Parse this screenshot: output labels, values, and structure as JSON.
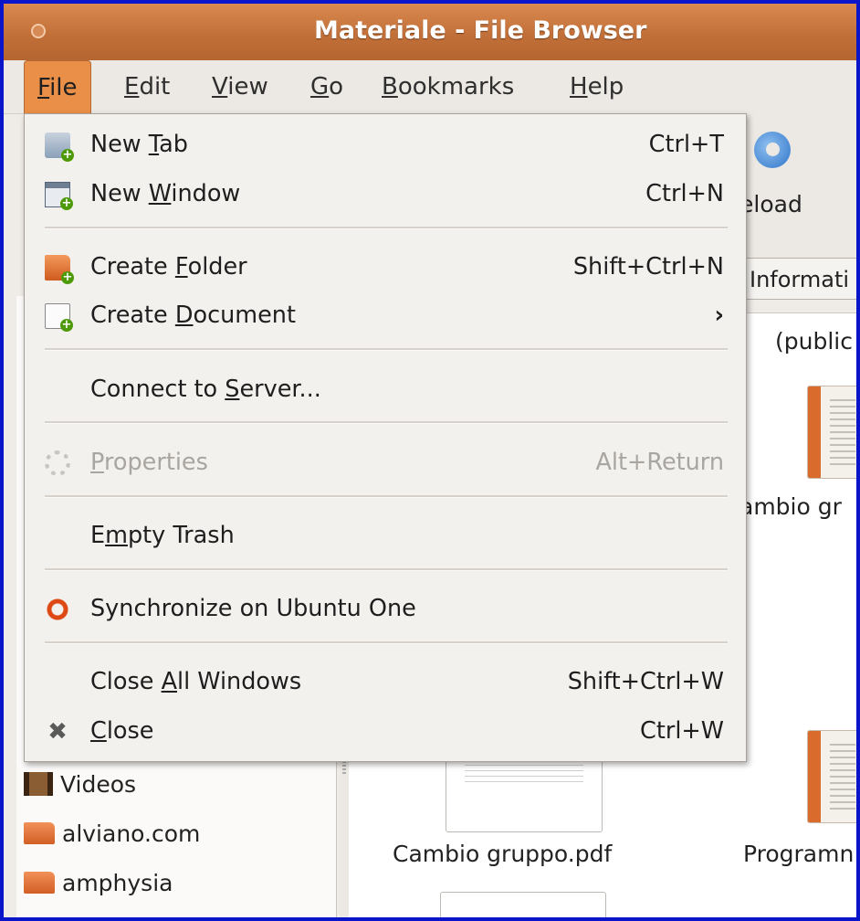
{
  "window": {
    "title": "Materiale - File Browser"
  },
  "menubar": [
    {
      "label": "File",
      "mnemonic": "F",
      "rest": "ile",
      "active": true
    },
    {
      "label": "Edit",
      "mnemonic": "E",
      "rest": "dit"
    },
    {
      "label": "View",
      "mnemonic": "V",
      "rest": "iew"
    },
    {
      "label": "Go",
      "mnemonic": "G",
      "rest": "o"
    },
    {
      "label": "Bookmarks",
      "mnemonic": "B",
      "rest": "ookmarks"
    },
    {
      "label": "Help",
      "mnemonic": "H",
      "rest": "elp"
    }
  ],
  "file_menu": {
    "new_tab": {
      "pre": "New ",
      "mn": "T",
      "post": "ab",
      "shortcut": "Ctrl+T",
      "icon": "new-tab-icon"
    },
    "new_window": {
      "pre": "New ",
      "mn": "W",
      "post": "indow",
      "shortcut": "Ctrl+N",
      "icon": "new-window-icon"
    },
    "create_folder": {
      "pre": "Create ",
      "mn": "F",
      "post": "older",
      "shortcut": "Shift+Ctrl+N",
      "icon": "new-folder-icon"
    },
    "create_document": {
      "pre": "Create ",
      "mn": "D",
      "post": "ocument",
      "submenu_arrow": "›",
      "icon": "new-document-icon"
    },
    "connect_server": {
      "pre": "Connect to ",
      "mn": "S",
      "post": "erver..."
    },
    "properties": {
      "pre": "",
      "mn": "P",
      "post": "roperties",
      "shortcut": "Alt+Return",
      "icon": "properties-gear-icon",
      "disabled": true
    },
    "empty_trash": {
      "pre": "E",
      "mn": "m",
      "post": "pty Trash"
    },
    "sync_ubuntu_one": {
      "label": "Synchronize on Ubuntu One",
      "icon": "ubuntu-one-icon"
    },
    "close_all": {
      "pre": "Close ",
      "mn": "A",
      "post": "ll Windows",
      "shortcut": "Shift+Ctrl+W"
    },
    "close": {
      "pre": "",
      "mn": "C",
      "post": "lose",
      "shortcut": "Ctrl+W",
      "icon": "close-x-icon"
    }
  },
  "toolbar": {
    "reload_label": "eload"
  },
  "info_tab": "Informati",
  "location": {
    "label": "(public"
  },
  "sidebar": {
    "items": [
      {
        "label": "Videos",
        "icon": "videos-folder-icon"
      },
      {
        "label": "alviano.com",
        "icon": "folder-icon"
      },
      {
        "label": "amphysia",
        "icon": "folder-icon"
      }
    ]
  },
  "files": {
    "top_right_label": "ambio gr",
    "cambio_gruppo": "Cambio gruppo.pdf",
    "programm": "Programn"
  }
}
